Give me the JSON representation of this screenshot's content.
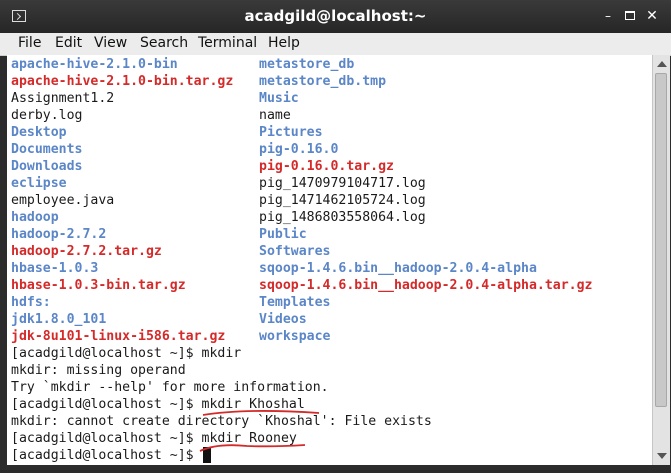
{
  "window": {
    "title": "acadgild@localhost:~",
    "minimize_label": "–",
    "close_label": "✕"
  },
  "menu": [
    "File",
    "Edit",
    "View",
    "Search",
    "Terminal",
    "Help"
  ],
  "listing_left": [
    {
      "text": "apache-hive-2.1.0-bin",
      "kind": "dir"
    },
    {
      "text": "apache-hive-2.1.0-bin.tar.gz",
      "kind": "arc"
    },
    {
      "text": "Assignment1.2",
      "kind": "file"
    },
    {
      "text": "derby.log",
      "kind": "file"
    },
    {
      "text": "Desktop",
      "kind": "dir"
    },
    {
      "text": "Documents",
      "kind": "dir"
    },
    {
      "text": "Downloads",
      "kind": "dir"
    },
    {
      "text": "eclipse",
      "kind": "dir"
    },
    {
      "text": "employee.java",
      "kind": "file"
    },
    {
      "text": "hadoop",
      "kind": "dir"
    },
    {
      "text": "hadoop-2.7.2",
      "kind": "dir"
    },
    {
      "text": "hadoop-2.7.2.tar.gz",
      "kind": "arc"
    },
    {
      "text": "hbase-1.0.3",
      "kind": "dir"
    },
    {
      "text": "hbase-1.0.3-bin.tar.gz",
      "kind": "arc"
    },
    {
      "text": "hdfs:",
      "kind": "dir"
    },
    {
      "text": "jdk1.8.0_101",
      "kind": "dir"
    },
    {
      "text": "jdk-8u101-linux-i586.tar.gz",
      "kind": "arc"
    }
  ],
  "listing_right": [
    {
      "text": "metastore_db",
      "kind": "dir"
    },
    {
      "text": "metastore_db.tmp",
      "kind": "dir"
    },
    {
      "text": "Music",
      "kind": "dir"
    },
    {
      "text": "name",
      "kind": "file"
    },
    {
      "text": "Pictures",
      "kind": "dir"
    },
    {
      "text": "pig-0.16.0",
      "kind": "dir"
    },
    {
      "text": "pig-0.16.0.tar.gz",
      "kind": "arc"
    },
    {
      "text": "pig_1470979104717.log",
      "kind": "file"
    },
    {
      "text": "pig_1471462105724.log",
      "kind": "file"
    },
    {
      "text": "pig_1486803558064.log",
      "kind": "file"
    },
    {
      "text": "Public",
      "kind": "dir"
    },
    {
      "text": "Softwares",
      "kind": "dir"
    },
    {
      "text": "sqoop-1.4.6.bin__hadoop-2.0.4-alpha",
      "kind": "dir"
    },
    {
      "text": "sqoop-1.4.6.bin__hadoop-2.0.4-alpha.tar.gz",
      "kind": "arc"
    },
    {
      "text": "Templates",
      "kind": "dir"
    },
    {
      "text": "Videos",
      "kind": "dir"
    },
    {
      "text": "workspace",
      "kind": "dir"
    }
  ],
  "output_lines": [
    "[acadgild@localhost ~]$ mkdir",
    "mkdir: missing operand",
    "Try `mkdir --help' for more information.",
    "[acadgild@localhost ~]$ mkdir Khoshal",
    "mkdir: cannot create directory `Khoshal': File exists",
    "[acadgild@localhost ~]$ mkdir Rooney",
    "[acadgild@localhost ~]$ "
  ],
  "colors": {
    "directory": "#5b86c7",
    "archive": "#d42a2a",
    "annotation": "#d42a2a"
  }
}
